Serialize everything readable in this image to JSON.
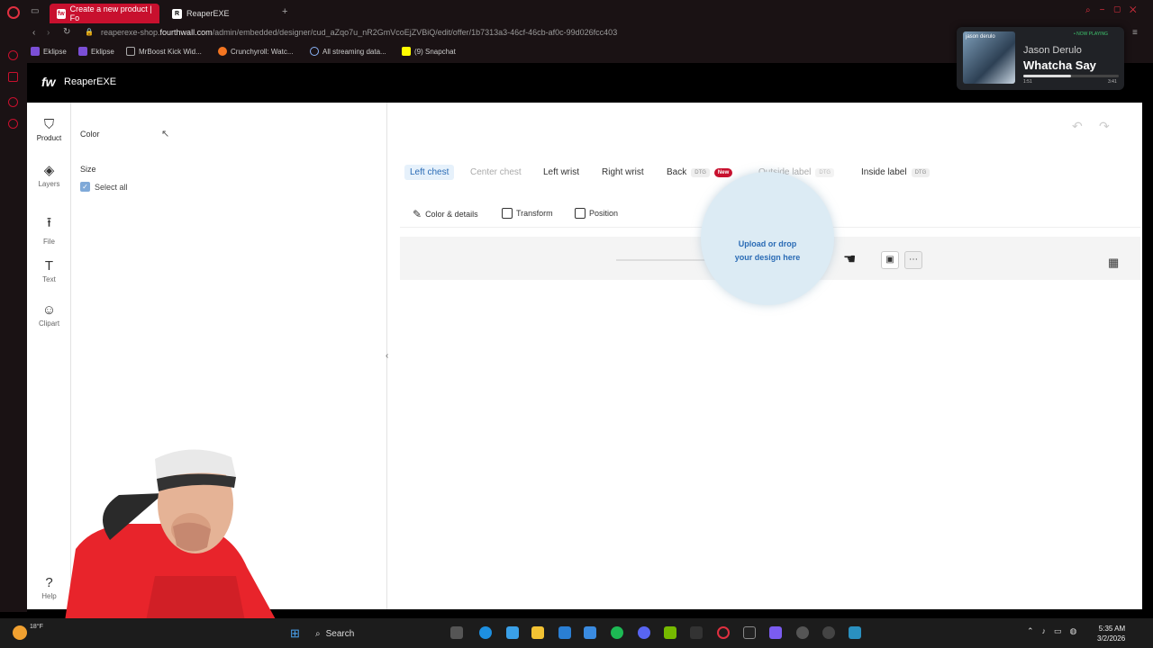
{
  "browser": {
    "tabs": [
      {
        "label": "Create a new product | Fo",
        "favicon": "fw"
      },
      {
        "label": "ReaperEXE",
        "favicon": "R"
      }
    ],
    "url_prefix": "reaperexe-shop.",
    "url_domain": "fourthwall.com",
    "url_path": "/admin/embedded/designer/cud_aZqo7u_nR2GmVcoEjZVBiQ/edit/offer/1b7313a3-46cf-46cb-af0c-99d026fcc403",
    "bookmarks": [
      "Eklipse",
      "Eklipse",
      "MrBoost Kick Wid...",
      "Crunchyroll: Watc...",
      "All streaming data...",
      "(9) Snapchat"
    ]
  },
  "now_playing": {
    "badge": "• NOW PLAYING",
    "album_text": "jason derulo",
    "artist": "Jason Derulo",
    "title": "Whatcha Say",
    "elapsed": "1:51",
    "duration": "3:41",
    "progress": 0.5
  },
  "app": {
    "logo": "fw",
    "store_name": "ReaperEXE"
  },
  "rail": [
    {
      "label": "Product",
      "icon": "shirt-icon"
    },
    {
      "label": "Layers",
      "icon": "layers-icon"
    },
    {
      "label": "File",
      "icon": "upload-icon"
    },
    {
      "label": "Text",
      "icon": "text-icon"
    },
    {
      "label": "Clipart",
      "icon": "smiley-icon"
    },
    {
      "label": "Help",
      "icon": "help-icon"
    }
  ],
  "options": {
    "color_label": "Color",
    "size_label": "Size",
    "select_all": "Select all"
  },
  "placements": [
    {
      "label": "Left chest",
      "tag": ""
    },
    {
      "label": "Center chest",
      "tag": ""
    },
    {
      "label": "Left wrist",
      "tag": ""
    },
    {
      "label": "Right wrist",
      "tag": ""
    },
    {
      "label": "Back",
      "tag": "DTG",
      "badge": "New"
    },
    {
      "label": "Outside label",
      "tag": "DTG"
    },
    {
      "label": "Inside label",
      "tag": "DTG"
    }
  ],
  "tools": [
    "Color & details",
    "Transform",
    "Position"
  ],
  "upload": {
    "line1": "Upload or drop",
    "line2": "your design here"
  },
  "taskbar": {
    "search": "Search",
    "temp": "18°F",
    "time": "5:35 AM",
    "date": "3/2/2026"
  }
}
